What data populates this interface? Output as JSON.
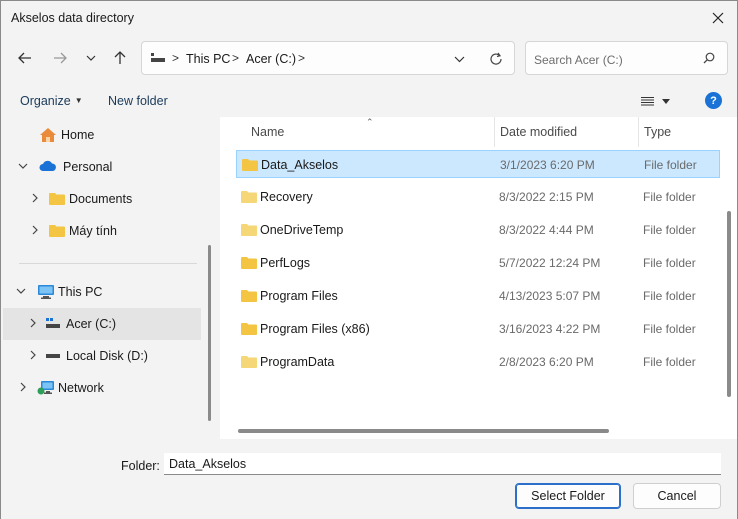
{
  "window": {
    "title": "Akselos data directory",
    "close_icon": "close-icon"
  },
  "navigation": {
    "back_icon": "arrow-left-icon",
    "forward_icon": "arrow-right-icon",
    "recent_icon": "chevron-down-icon",
    "up_icon": "arrow-up-icon"
  },
  "address": {
    "crumbs": [
      "This PC",
      "Acer (C:)"
    ],
    "separator": ">",
    "refresh_icon": "refresh-icon"
  },
  "search": {
    "placeholder": "Search Acer (C:)",
    "icon": "search-icon"
  },
  "toolbar": {
    "organize_label": "Organize",
    "new_folder_label": "New folder",
    "help_label": "?"
  },
  "sidebar": {
    "items": [
      {
        "label": "Home",
        "icon": "home-icon"
      },
      {
        "label": "Personal",
        "icon": "cloud-icon"
      },
      {
        "label": "Documents",
        "icon": "folder-icon"
      },
      {
        "label": "Máy tính",
        "icon": "folder-icon"
      },
      {
        "label": "This PC",
        "icon": "computer-icon"
      },
      {
        "label": "Acer (C:)",
        "icon": "drive-icon",
        "selected": true
      },
      {
        "label": "Local Disk (D:)",
        "icon": "drive-icon"
      },
      {
        "label": "Network",
        "icon": "network-icon"
      }
    ]
  },
  "columns": {
    "name": "Name",
    "date": "Date modified",
    "type": "Type"
  },
  "files": [
    {
      "name": "Data_Akselos",
      "date": "3/1/2023 6:20 PM",
      "type": "File folder",
      "selected": true
    },
    {
      "name": "Recovery",
      "date": "8/3/2022 2:15 PM",
      "type": "File folder"
    },
    {
      "name": "OneDriveTemp",
      "date": "8/3/2022 4:44 PM",
      "type": "File folder"
    },
    {
      "name": "PerfLogs",
      "date": "5/7/2022 12:24 PM",
      "type": "File folder"
    },
    {
      "name": "Program Files",
      "date": "4/13/2023 5:07 PM",
      "type": "File folder"
    },
    {
      "name": "Program Files (x86)",
      "date": "3/16/2023 4:22 PM",
      "type": "File folder"
    },
    {
      "name": "ProgramData",
      "date": "2/8/2023 6:20 PM",
      "type": "File folder"
    }
  ],
  "footer": {
    "folder_label": "Folder:",
    "folder_value": "Data_Akselos",
    "select_label": "Select Folder",
    "cancel_label": "Cancel"
  },
  "colors": {
    "selection": "#cce8ff",
    "accent": "#1a72d6",
    "folder": "#f4c542"
  }
}
